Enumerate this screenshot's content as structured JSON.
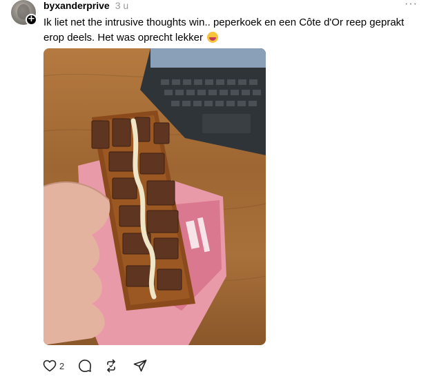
{
  "post": {
    "username": "byxanderprive",
    "timestamp": "3 u",
    "more_label": "···",
    "follow_badge": "+",
    "caption": "Ik liet net the intrusive thoughts win.. peperkoek en een Côte d'Or reep geprakt erop deels. Het was oprecht lekker",
    "emoji": "grinning-tongue-emoji",
    "image_icon": "photo-peperkoek-chocolate",
    "actions": {
      "like_count": "2",
      "icons": [
        "heart-icon",
        "comment-icon",
        "repost-icon",
        "share-icon"
      ]
    }
  },
  "colors": {
    "text": "#000000",
    "muted": "#999999",
    "background": "#ffffff"
  }
}
